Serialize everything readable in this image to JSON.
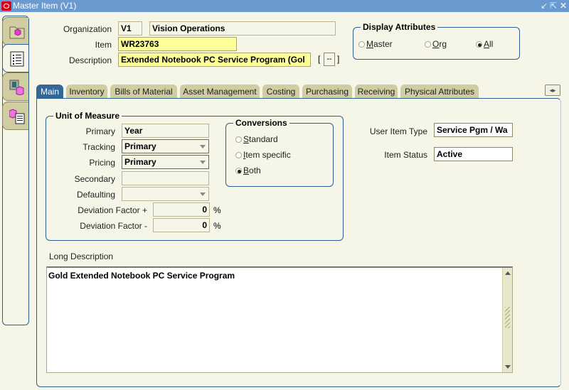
{
  "window": {
    "title": "Master Item (V1)",
    "controls": [
      "minimize-icon",
      "maximize-icon",
      "close-icon"
    ]
  },
  "left_tabs": [
    {
      "name": "folder-item",
      "icon": "folder-cube-icon",
      "active": false
    },
    {
      "name": "list",
      "icon": "list-icon",
      "active": true
    },
    {
      "name": "org-item",
      "icon": "building-cube-icon",
      "active": false
    },
    {
      "name": "item-list",
      "icon": "cube-list-icon",
      "active": false
    }
  ],
  "header": {
    "organization_label": "Organization",
    "organization_code": "V1",
    "organization_name": "Vision Operations",
    "item_label": "Item",
    "item_value": "WR23763",
    "description_label": "Description",
    "description_value": "Extended Notebook PC Service Program (Gol",
    "flex_button_label": "--"
  },
  "display_attributes": {
    "title": "Display Attributes",
    "options": [
      {
        "label": "Master",
        "mnemonic": "M",
        "rest": "aster",
        "selected": false
      },
      {
        "label": "Org",
        "mnemonic": "O",
        "rest": "rg",
        "selected": false
      },
      {
        "label": "All",
        "mnemonic": "A",
        "rest": "ll",
        "selected": true
      }
    ]
  },
  "tabs": [
    {
      "label": "Main",
      "active": true
    },
    {
      "label": "Inventory",
      "active": false
    },
    {
      "label": "Bills of Material",
      "active": false
    },
    {
      "label": "Asset Management",
      "active": false
    },
    {
      "label": "Costing",
      "active": false
    },
    {
      "label": "Purchasing",
      "active": false
    },
    {
      "label": "Receiving",
      "active": false
    },
    {
      "label": "Physical Attributes",
      "active": false
    }
  ],
  "unit_of_measure": {
    "title": "Unit of Measure",
    "primary_label": "Primary",
    "primary_value": "Year",
    "tracking_label": "Tracking",
    "tracking_value": "Primary",
    "pricing_label": "Pricing",
    "pricing_value": "Primary",
    "secondary_label": "Secondary",
    "secondary_value": "",
    "defaulting_label": "Defaulting",
    "defaulting_value": "",
    "dev_plus_label": "Deviation Factor +",
    "dev_plus_value": "0",
    "dev_minus_label": "Deviation Factor -",
    "dev_minus_value": "0",
    "percent": "%"
  },
  "conversions": {
    "title": "Conversions",
    "options": [
      {
        "label": "Standard",
        "mnemonic": "S",
        "rest": "tandard",
        "selected": false
      },
      {
        "label": "Item specific",
        "mnemonic": "I",
        "rest": "tem specific",
        "selected": false
      },
      {
        "label": "Both",
        "mnemonic": "B",
        "rest": "oth",
        "selected": true
      }
    ]
  },
  "item_info": {
    "user_item_type_label": "User Item Type",
    "user_item_type_value": "Service Pgm / Wa",
    "item_status_label": "Item Status",
    "item_status_value": "Active"
  },
  "long_description": {
    "label": "Long Description",
    "value": "Gold Extended Notebook PC Service Program"
  }
}
